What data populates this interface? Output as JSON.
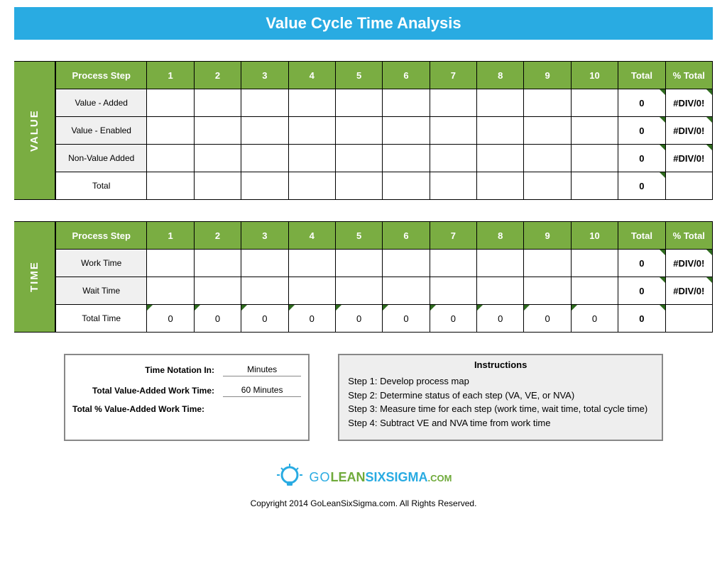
{
  "title": "Value Cycle Time Analysis",
  "columns": {
    "process_step": "Process Step",
    "steps": [
      "1",
      "2",
      "3",
      "4",
      "5",
      "6",
      "7",
      "8",
      "9",
      "10"
    ],
    "total": "Total",
    "pct_total": "% Total"
  },
  "value_section": {
    "label": "VALUE",
    "rows": [
      {
        "label": "Value - Added",
        "steps": [
          "",
          "",
          "",
          "",
          "",
          "",
          "",
          "",
          "",
          ""
        ],
        "total": "0",
        "pct": "#DIV/0!"
      },
      {
        "label": "Value - Enabled",
        "steps": [
          "",
          "",
          "",
          "",
          "",
          "",
          "",
          "",
          "",
          ""
        ],
        "total": "0",
        "pct": "#DIV/0!"
      },
      {
        "label": "Non-Value Added",
        "steps": [
          "",
          "",
          "",
          "",
          "",
          "",
          "",
          "",
          "",
          ""
        ],
        "total": "0",
        "pct": "#DIV/0!"
      },
      {
        "label": "Total",
        "steps": [
          "",
          "",
          "",
          "",
          "",
          "",
          "",
          "",
          "",
          ""
        ],
        "total": "0",
        "pct": ""
      }
    ]
  },
  "time_section": {
    "label": "TIME",
    "rows": [
      {
        "label": "Work Time",
        "steps": [
          "",
          "",
          "",
          "",
          "",
          "",
          "",
          "",
          "",
          ""
        ],
        "total": "0",
        "pct": "#DIV/0!"
      },
      {
        "label": "Wait Time",
        "steps": [
          "",
          "",
          "",
          "",
          "",
          "",
          "",
          "",
          "",
          ""
        ],
        "total": "0",
        "pct": "#DIV/0!"
      },
      {
        "label": "Total Time",
        "steps": [
          "0",
          "0",
          "0",
          "0",
          "0",
          "0",
          "0",
          "0",
          "0",
          "0"
        ],
        "total": "0",
        "pct": ""
      }
    ]
  },
  "summary": {
    "time_notation_label": "Time Notation In:",
    "time_notation_value": "Minutes",
    "total_va_label": "Total Value-Added Work Time:",
    "total_va_value": "60 Minutes",
    "pct_va_label": "Total % Value-Added Work Time:",
    "pct_va_value": ""
  },
  "instructions": {
    "header": "Instructions",
    "steps": [
      "Step 1:  Develop process map",
      "Step 2:  Determine status of each step (VA, VE, or NVA)",
      "Step 3:  Measure time for each step (work time, wait time, total cycle time)",
      "Step 4:  Subtract VE and NVA time from work time"
    ]
  },
  "logo": {
    "go": "GO",
    "lean": "LEAN",
    "six": "SIXSIGMA",
    "com": ".COM"
  },
  "copyright": "Copyright 2014 GoLeanSixSigma.com. All Rights Reserved."
}
